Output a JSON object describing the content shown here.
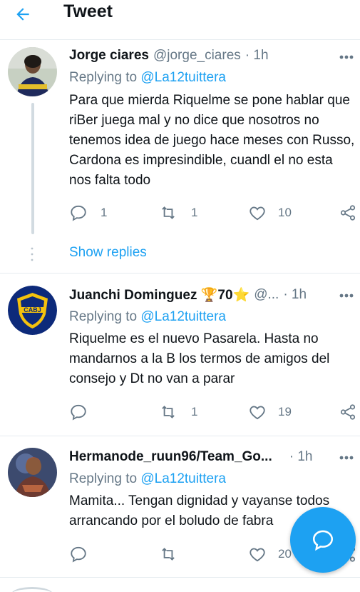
{
  "header": {
    "title": "Tweet",
    "back_icon": "arrow-left-icon"
  },
  "tweets": [
    {
      "name": "Jorge ciares",
      "handle": "@jorge_ciares",
      "time": "· 1h",
      "replying_prefix": "Replying to",
      "replying_to": "@La12tuittera",
      "text": "Para que mierda Riquelme se pone hablar que riBer juega mal y no dice que nosotros no tenemos idea de juego hace meses con Russo, Cardona es impresindible, cuandl el no esta nos falta todo",
      "replies": "1",
      "retweets": "1",
      "likes": "10"
    },
    {
      "name": "Juanchi Dominguez 🏆70⭐",
      "handle": "@...",
      "time": "· 1h",
      "replying_prefix": "Replying to",
      "replying_to": "@La12tuittera",
      "text": "Riquelme es el nuevo Pasarela. Hasta no mandarnos a la B los termos de amigos del consejo y Dt no van a parar",
      "replies": "",
      "retweets": "1",
      "likes": "19"
    },
    {
      "name": "Hermanode_ruun96/Team_Go...",
      "handle": "",
      "time": "· 1h",
      "replying_prefix": "Replying to",
      "replying_to": "@La12tuittera",
      "text": "Mamita... Tengan dignidad y vayanse todos arrancando por el boludo de fabra",
      "replies": "",
      "retweets": "",
      "likes": "20"
    }
  ],
  "show_replies": "Show replies",
  "colors": {
    "accent": "#1da1f2",
    "muted": "#657786",
    "text": "#0f1419",
    "divider": "#e6ecf0"
  }
}
